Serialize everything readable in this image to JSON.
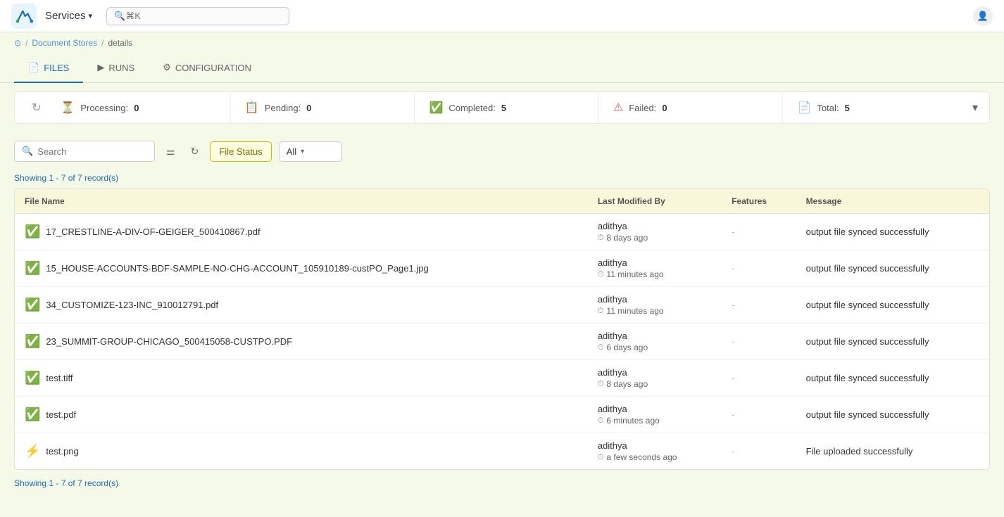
{
  "topnav": {
    "services_label": "Services",
    "search_placeholder": "⌘K",
    "user_icon": "👤"
  },
  "breadcrumb": {
    "home_icon": "⊙",
    "document_stores": "Document Stores",
    "sep1": "/",
    "details": "details"
  },
  "tabs": [
    {
      "id": "files",
      "label": "FILES",
      "icon": "📄",
      "active": true
    },
    {
      "id": "runs",
      "label": "RUNS",
      "icon": "▶",
      "active": false
    },
    {
      "id": "configuration",
      "label": "CONFIGURATION",
      "icon": "⚙",
      "active": false
    }
  ],
  "stats": {
    "processing_label": "Processing:",
    "processing_value": "0",
    "pending_label": "Pending:",
    "pending_value": "0",
    "completed_label": "Completed:",
    "completed_value": "5",
    "failed_label": "Failed:",
    "failed_value": "0",
    "total_label": "Total:",
    "total_value": "5"
  },
  "toolbar": {
    "search_placeholder": "Search",
    "file_status_label": "File Status",
    "status_all": "All"
  },
  "record_count_top": "Showing 1 - 7 of 7 record(s)",
  "record_count_bottom": "Showing 1 - 7 of 7 record(s)",
  "table": {
    "headers": [
      "File Name",
      "Last Modified By",
      "Features",
      "Message"
    ],
    "rows": [
      {
        "status": "green",
        "file_name": "17_CRESTLINE-A-DIV-OF-GEIGER_500410867.pdf",
        "modified_by": "adithya",
        "modified_time": "8 days ago",
        "features": "-",
        "message": "output file synced successfully"
      },
      {
        "status": "green",
        "file_name": "15_HOUSE-ACCOUNTS-BDF-SAMPLE-NO-CHG-ACCOUNT_105910189-custPO_Page1.jpg",
        "modified_by": "adithya",
        "modified_time": "11 minutes ago",
        "features": "-",
        "message": "output file synced successfully"
      },
      {
        "status": "green",
        "file_name": "34_CUSTOMIZE-123-INC_910012791.pdf",
        "modified_by": "adithya",
        "modified_time": "11 minutes ago",
        "features": "-",
        "message": "output file synced successfully"
      },
      {
        "status": "green",
        "file_name": "23_SUMMIT-GROUP-CHICAGO_500415058-CUSTPO.PDF",
        "modified_by": "adithya",
        "modified_time": "6 days ago",
        "features": "-",
        "message": "output file synced successfully"
      },
      {
        "status": "green",
        "file_name": "test.tiff",
        "modified_by": "adithya",
        "modified_time": "8 days ago",
        "features": "-",
        "message": "output file synced successfully"
      },
      {
        "status": "green",
        "file_name": "test.pdf",
        "modified_by": "adithya",
        "modified_time": "6 minutes ago",
        "features": "-",
        "message": "output file synced successfully"
      },
      {
        "status": "yellow",
        "file_name": "test.png",
        "modified_by": "adithya",
        "modified_time": "a few seconds ago",
        "features": "-",
        "message": "File uploaded successfully"
      }
    ]
  }
}
